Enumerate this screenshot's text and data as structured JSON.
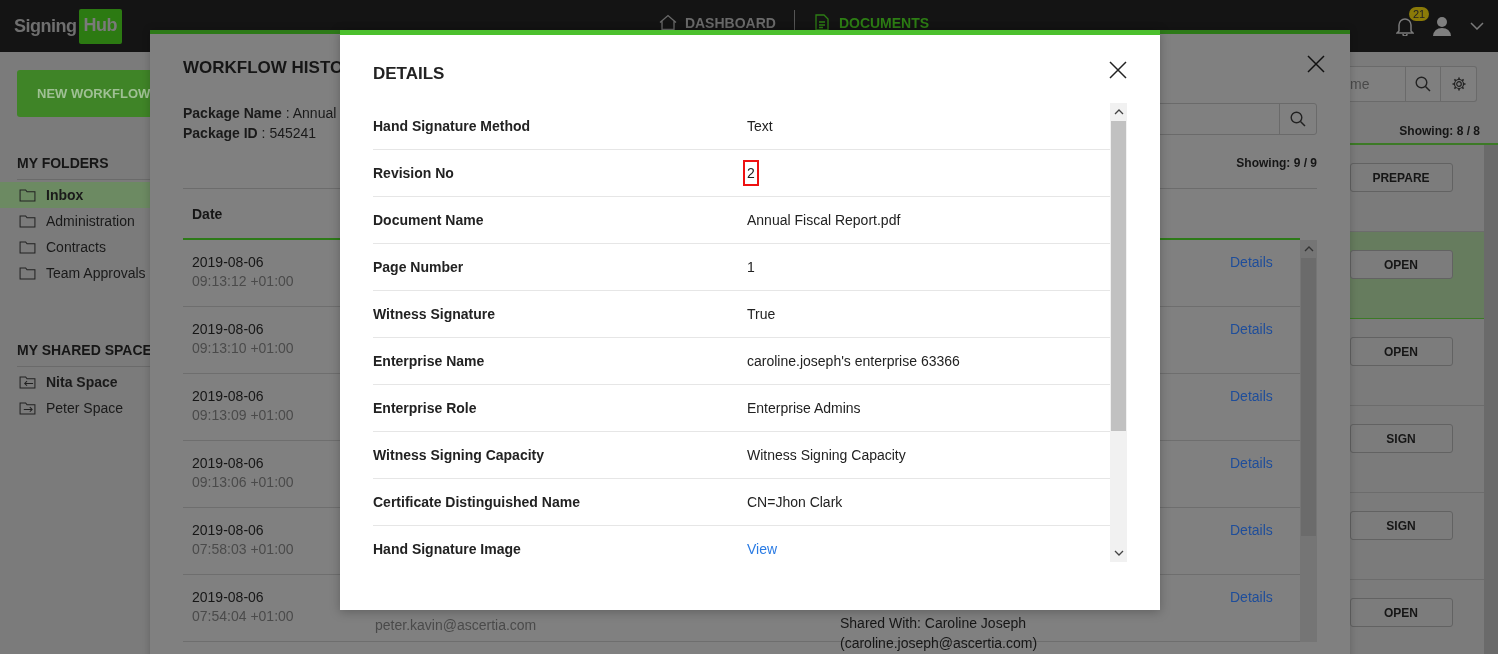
{
  "header": {
    "logo": {
      "text": "Signing",
      "badge": "Hub"
    },
    "nav": [
      {
        "label": "DASHBOARD",
        "selected": false,
        "kind": "home"
      },
      {
        "label": "DOCUMENTS",
        "selected": true,
        "kind": "document"
      }
    ],
    "notifications": "21"
  },
  "sidebar": {
    "new_button": "NEW WORKFLOW",
    "sections": [
      {
        "title": "MY FOLDERS",
        "items": [
          {
            "label": "Inbox",
            "selected": true,
            "unread": false,
            "kind": "folder"
          },
          {
            "label": "Administration",
            "selected": false,
            "unread": false,
            "kind": "folder"
          },
          {
            "label": "Contracts",
            "selected": false,
            "unread": false,
            "kind": "folder"
          },
          {
            "label": "Team Approvals",
            "selected": false,
            "unread": false,
            "kind": "folder"
          }
        ]
      },
      {
        "title": "MY SHARED SPACE",
        "items": [
          {
            "label": "Nita Space",
            "selected": false,
            "unread": true,
            "kind": "shared-in"
          },
          {
            "label": "Peter Space",
            "selected": false,
            "unread": false,
            "kind": "shared-out"
          }
        ]
      }
    ]
  },
  "documents": {
    "search_placeholder": "me",
    "showing": "Showing: 8 / 8",
    "rows": [
      {
        "action": "PREPARE",
        "selected": false
      },
      {
        "action": "OPEN",
        "selected": true
      },
      {
        "action": "OPEN",
        "selected": false
      },
      {
        "action": "SIGN",
        "selected": false
      },
      {
        "action": "SIGN",
        "selected": false
      },
      {
        "action": "OPEN",
        "selected": false
      }
    ]
  },
  "workflow_history": {
    "title": "WORKFLOW HISTO",
    "package_name_label": "Package Name",
    "package_name": ": Annual",
    "package_id_label": "Package ID",
    "package_id": ": 545241",
    "showing": "Showing: 9 / 9",
    "columns": [
      "Date"
    ],
    "rows": [
      {
        "date": "2019-08-06",
        "time": "09:13:12 +01:00",
        "link": "Details"
      },
      {
        "date": "2019-08-06",
        "time": "09:13:10 +01:00",
        "link": "Details"
      },
      {
        "date": "2019-08-06",
        "time": "09:13:09 +01:00",
        "link": "Details"
      },
      {
        "date": "2019-08-06",
        "time": "09:13:06 +01:00",
        "link": "Details"
      },
      {
        "date": "2019-08-06",
        "time": "07:58:03 +01:00",
        "link": "Details"
      },
      {
        "date": "2019-08-06",
        "time": "07:54:04 +01:00",
        "link": "Details",
        "user": "peter.kavin@ascertia.com",
        "info": "Shared With: Caroline Joseph (caroline.joseph@ascertia.com)"
      }
    ]
  },
  "details": {
    "title": "DETAILS",
    "rows": [
      {
        "label": "Hand Signature Method",
        "value": "Text",
        "kind": "text",
        "highlighted": false
      },
      {
        "label": "Revision No",
        "value": "2",
        "kind": "text",
        "highlighted": true
      },
      {
        "label": "Document Name",
        "value": "Annual Fiscal Report.pdf",
        "kind": "text",
        "highlighted": false
      },
      {
        "label": "Page Number",
        "value": "1",
        "kind": "text",
        "highlighted": false
      },
      {
        "label": "Witness Signature",
        "value": "True",
        "kind": "text",
        "highlighted": false
      },
      {
        "label": "Enterprise Name",
        "value": "caroline.joseph's enterprise 63366",
        "kind": "text",
        "highlighted": false
      },
      {
        "label": "Enterprise Role",
        "value": "Enterprise Admins",
        "kind": "text",
        "highlighted": false
      },
      {
        "label": "Witness Signing Capacity",
        "value": "Witness Signing Capacity",
        "kind": "text",
        "highlighted": false
      },
      {
        "label": "Certificate Distinguished Name",
        "value": "CN=Jhon Clark",
        "kind": "text",
        "highlighted": false
      },
      {
        "label": "Hand Signature Image",
        "value": "View",
        "kind": "link",
        "highlighted": false
      }
    ]
  }
}
